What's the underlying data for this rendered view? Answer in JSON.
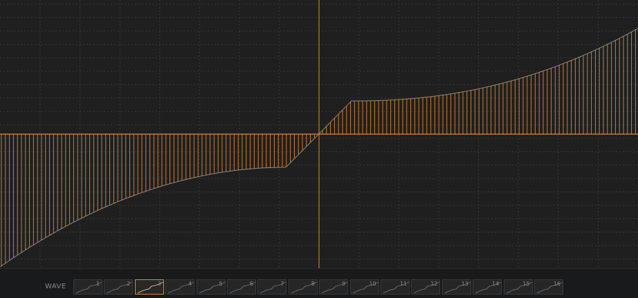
{
  "wave_label": "WAVE",
  "selected_wave": 3,
  "colors": {
    "background": "#1f1f20",
    "grid": "#3a3a3b",
    "accent": "#e08a2c"
  },
  "slots": [
    {
      "number": "1"
    },
    {
      "number": "2"
    },
    {
      "number": "3"
    },
    {
      "number": "4"
    },
    {
      "number": "5"
    },
    {
      "number": "6"
    },
    {
      "number": "7"
    },
    {
      "number": "8"
    },
    {
      "number": "9"
    },
    {
      "number": "10"
    },
    {
      "number": "11"
    },
    {
      "number": "12"
    },
    {
      "number": "13"
    },
    {
      "number": "14"
    },
    {
      "number": "15"
    },
    {
      "number": "16"
    }
  ]
}
